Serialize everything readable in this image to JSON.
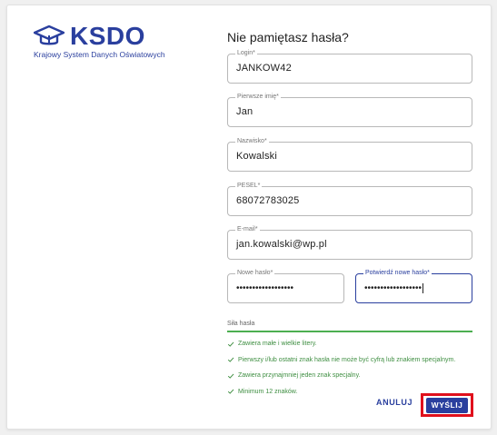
{
  "logo": {
    "brand": "KSDO",
    "subtitle": "Krajowy System Danych Oświatowych",
    "brand_color": "#2a3f9e",
    "icon": "graduation-cap-icon"
  },
  "form": {
    "title": "Nie pamiętasz hasła?",
    "fields": {
      "login": {
        "label": "Login*",
        "value": "JANKOW42"
      },
      "first_name": {
        "label": "Pierwsze imię*",
        "value": "Jan"
      },
      "last_name": {
        "label": "Nazwisko*",
        "value": "Kowalski"
      },
      "pesel": {
        "label": "PESEL*",
        "value": "68072783025"
      },
      "email": {
        "label": "E-mail*",
        "value": "jan.kowalski@wp.pl"
      },
      "new_password": {
        "label": "Nowe hasło*",
        "value": "••••••••••••••••••"
      },
      "confirm_password": {
        "label": "Potwierdź nowe hasło*",
        "value": "••••••••••••••••••"
      }
    },
    "strength": {
      "label": "Siła hasła",
      "level": 1.0,
      "color": "#4caf50"
    },
    "rules": [
      "Zawiera małe i wielkie litery.",
      "Pierwszy i/lub ostatni znak hasła nie może być cyfrą lub znakiem specjalnym.",
      "Zawiera przynajmniej jeden znak specjalny.",
      "Minimum 12 znaków."
    ],
    "rule_color": "#3e8e41",
    "buttons": {
      "cancel": "ANULUJ",
      "submit": "WYŚLIJ"
    },
    "highlight_color": "#e0101c"
  }
}
